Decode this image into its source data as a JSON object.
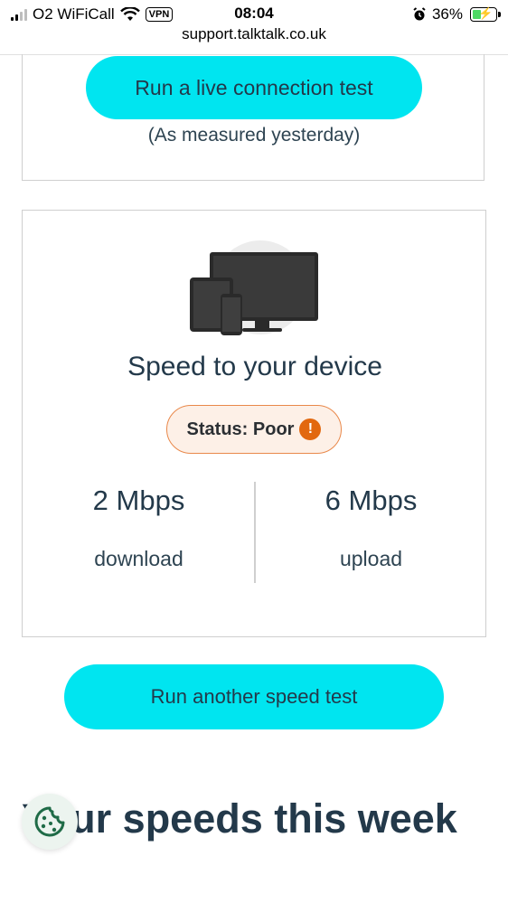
{
  "status_bar": {
    "carrier": "O2 WiFiCall",
    "vpn": "VPN",
    "time": "08:04",
    "battery": "36%"
  },
  "url": "support.talktalk.co.uk",
  "live_test": {
    "button_label": "Run a live connection test",
    "measured_note": "(As measured yesterday)"
  },
  "device_card": {
    "title": "Speed to your device",
    "status": "Status: Poor",
    "status_icon": "warning-icon",
    "download_value": "2 Mbps",
    "download_label": "download",
    "upload_value": "6 Mbps",
    "upload_label": "upload"
  },
  "speed_test": {
    "button_label": "Run another speed test"
  },
  "section_heading": "Your speeds this week",
  "colors": {
    "accent": "#00e5f0",
    "text": "#23394a",
    "warning": "#e2680f",
    "warning_bg": "#fdf0e7"
  }
}
